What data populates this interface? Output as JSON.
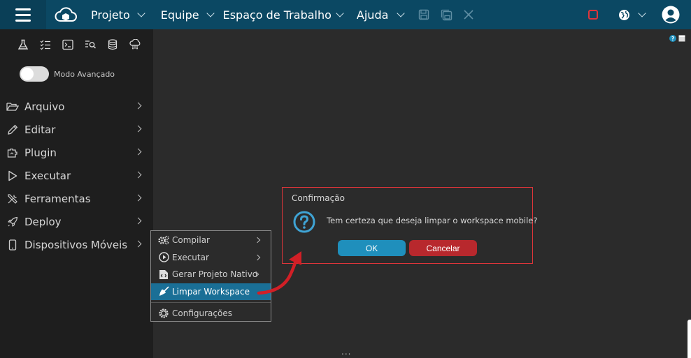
{
  "topbar": {
    "menus": [
      {
        "label": "Projeto"
      },
      {
        "label": "Equipe"
      },
      {
        "label": "Espaço de Trabalho"
      },
      {
        "label": "Ajuda"
      }
    ],
    "icons": [
      "hamburger-icon",
      "cloud-logo-icon",
      "save-icon",
      "save-all-icon",
      "close-icon",
      "stop-icon",
      "globe-icon",
      "user-icon"
    ],
    "accent": "#0b4863",
    "stop_color": "#e0353a"
  },
  "sidebar": {
    "tool_icons": [
      "flask-icon",
      "checklist-icon",
      "terminal-icon",
      "search-list-icon",
      "database-icon",
      "cloud-network-icon"
    ],
    "advanced_mode_label": "Modo Avançado",
    "items": [
      {
        "label": "Arquivo",
        "icon": "folder-open-icon"
      },
      {
        "label": "Editar",
        "icon": "pencil-icon"
      },
      {
        "label": "Plugin",
        "icon": "plugin-icon"
      },
      {
        "label": "Executar",
        "icon": "play-icon"
      },
      {
        "label": "Ferramentas",
        "icon": "tools-icon"
      },
      {
        "label": "Deploy",
        "icon": "rocket-icon"
      },
      {
        "label": "Dispositivos Móveis",
        "icon": "mobile-icon"
      }
    ]
  },
  "submenu": {
    "items": [
      {
        "label": "Compilar",
        "icon": "gears-icon"
      },
      {
        "label": "Executar",
        "icon": "play-circle-icon"
      },
      {
        "label": "Gerar Projeto Nativo",
        "icon": "code-file-icon"
      },
      {
        "label": "Limpar Workspace",
        "icon": "broom-icon",
        "active": true
      },
      {
        "label": "Configurações",
        "icon": "gear-icon"
      }
    ],
    "active_color": "#1a6f96"
  },
  "dialog": {
    "title": "Confirmação",
    "message": "Tem certeza que deseja limpar o workspace mobile?",
    "ok_label": "OK",
    "cancel_label": "Cancelar",
    "border_color": "#e0353a",
    "ok_color": "#1f8fbc",
    "cancel_color": "#b8282d"
  },
  "main": {
    "dots": "..."
  }
}
